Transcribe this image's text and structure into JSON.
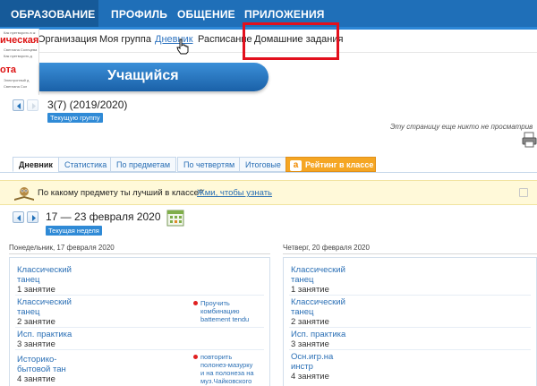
{
  "top_nav": [
    "ОБРАЗОВАНИЕ",
    "ПРОФИЛЬ",
    "ОБЩЕНИЕ",
    "ПРИЛОЖЕНИЯ"
  ],
  "sub_nav": [
    "Организация",
    "Моя группа",
    "Дневник",
    "Расписание",
    "Домашние задания"
  ],
  "sticker": {
    "line1": "ическая",
    "line2": "ота",
    "tiny": [
      "Как претворить в ж",
      "Светлана Солнцева",
      "Как претворить д",
      "Электронный д",
      "Светлана Сол"
    ]
  },
  "banner_title": "Учащийся",
  "group": {
    "name": "3(7) (2019/2020)",
    "current_chip": "Текущую группу"
  },
  "not_viewed": "Эту страницу еще никто не просматрив",
  "tabs": [
    "Дневник",
    "Статистика",
    "По предметам",
    "По четвертям",
    "Итоговые",
    "Рейтинг в классе"
  ],
  "rating_logo": "a",
  "notice": {
    "question": "По какому предмету ты лучший в классе?",
    "link": "Жми, чтобы узнать"
  },
  "week": {
    "range": "17 — 23 февраля 2020",
    "current_chip": "Текущая неделя"
  },
  "days": [
    {
      "header": "Понедельник, 17 февраля 2020",
      "lessons": [
        {
          "name": [
            "Классический",
            "танец"
          ],
          "count": "1 занятие",
          "homework": []
        },
        {
          "name": [
            "Классический",
            "танец"
          ],
          "count": "2 занятие",
          "homework": [
            "Проучить",
            "комбинацию",
            "battement tendu"
          ]
        },
        {
          "name": [
            "Исп. практика"
          ],
          "count": "3 занятие",
          "homework": []
        },
        {
          "name": [
            "Историко-",
            "бытовой тан"
          ],
          "count": "4 занятие",
          "homework": [
            "повторить",
            "полонез-мазурку",
            "и на полонеза на",
            "муз.Чайковского"
          ]
        }
      ]
    },
    {
      "header": "Четверг, 20 февраля 2020",
      "lessons": [
        {
          "name": [
            "Классический",
            "танец"
          ],
          "count": "1 занятие",
          "homework": []
        },
        {
          "name": [
            "Классический",
            "танец"
          ],
          "count": "2 занятие",
          "homework": []
        },
        {
          "name": [
            "Исп. практика"
          ],
          "count": "3 занятие",
          "homework": []
        },
        {
          "name": [
            "Осн.игр.на",
            "инстр"
          ],
          "count": "4 занятие",
          "homework": []
        }
      ]
    }
  ],
  "colors": {
    "nav": "#1f6fb8",
    "link": "#2a6fb5",
    "chip": "#2f8ad6",
    "highlight": "#e3101d",
    "rating": "#f5a623"
  }
}
